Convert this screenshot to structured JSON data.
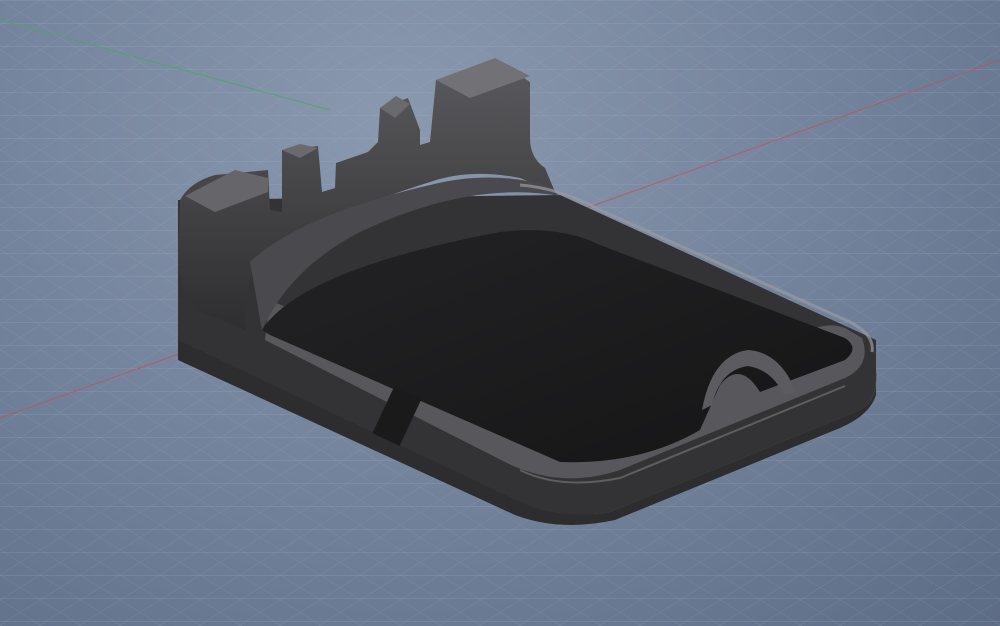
{
  "viewport": {
    "label": "",
    "background_color": "#7585a0",
    "grid_color": "#9fb0c6",
    "axis_x_color": "#c0525a",
    "axis_y_color": "#4aa860"
  },
  "model": {
    "name": "",
    "body_color": "#3a3a3c",
    "floor_color": "#1d1d1f",
    "highlight_color": "#6e6e72"
  }
}
